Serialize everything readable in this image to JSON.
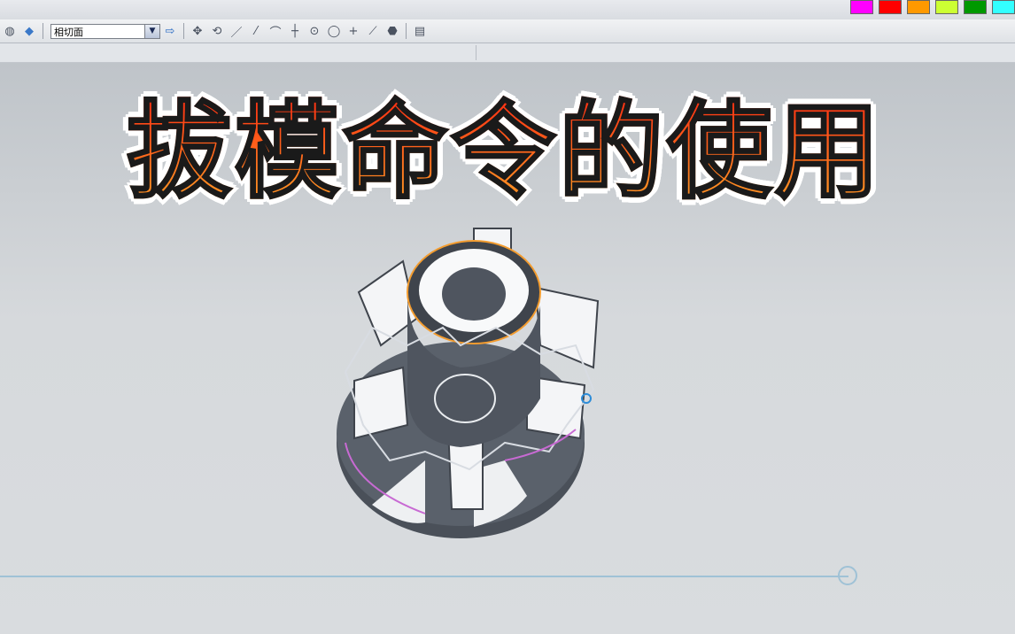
{
  "toolbar": {
    "section_combo_value": "相切面",
    "icons": [
      "render-style-icon",
      "shaded-cube-icon",
      "combo-arrow-icon",
      "apply-arrow-icon",
      "move-icon",
      "rotate-icon",
      "line-icon",
      "line2-icon",
      "curve-icon",
      "crosshair-icon",
      "circle-center-icon",
      "circle-icon",
      "plus-icon",
      "diagonal-icon",
      "shape-icon",
      "page-icon"
    ]
  },
  "palette": [
    "#ff00ff",
    "#ff0000",
    "#ff9900",
    "#ccff33",
    "#009900",
    "#33ffff"
  ],
  "title": "拔模命令的使用",
  "model": {
    "name": "gear-part",
    "body_color": "#4f555f",
    "face_color": "#f4f5f7",
    "edge_highlight": "#f39c2f"
  }
}
